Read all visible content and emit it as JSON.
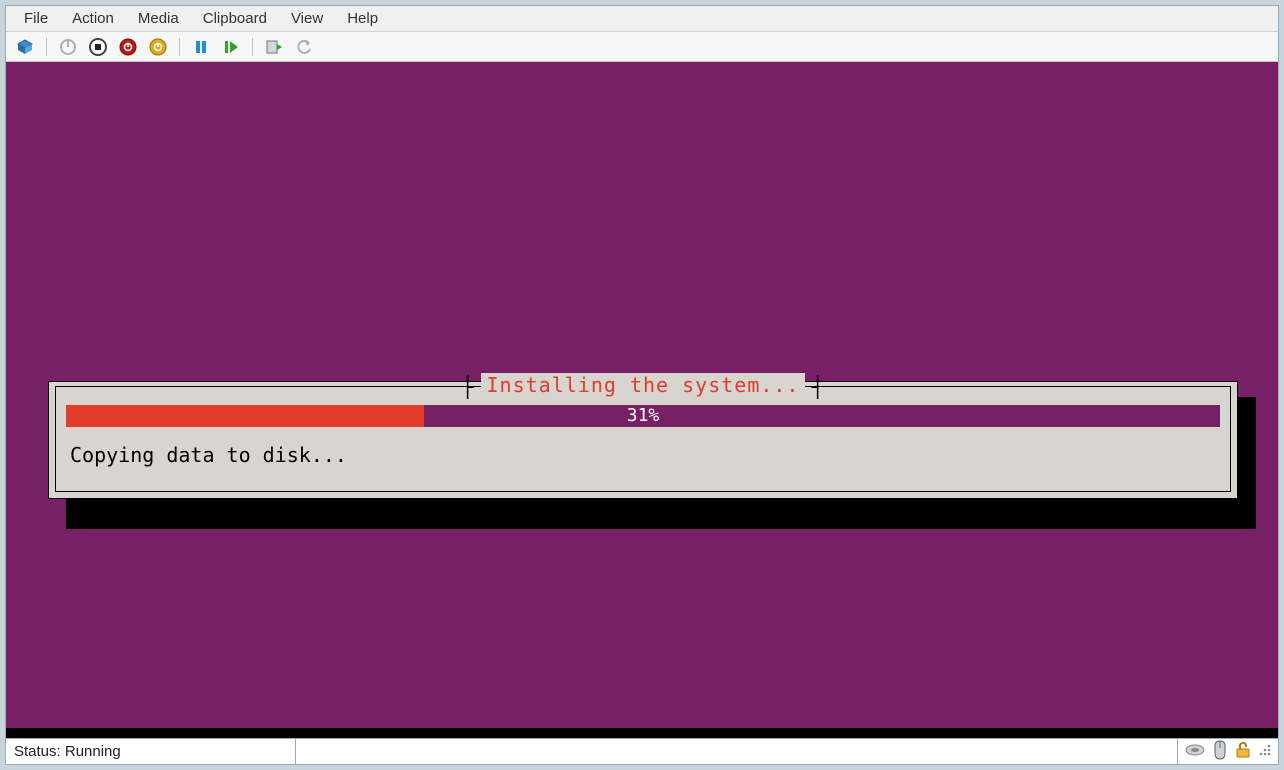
{
  "menu": {
    "file": "File",
    "action": "Action",
    "media": "Media",
    "clipboard": "Clipboard",
    "view": "View",
    "help": "Help"
  },
  "installer": {
    "title": "Installing the system...",
    "progress_percent": 31,
    "progress_label": "31%",
    "status": "Copying data to disk..."
  },
  "statusbar": {
    "text": "Status: Running"
  },
  "colors": {
    "vm_bg": "#782066",
    "progress_fill": "#e13b2a",
    "title_color": "#e13b2a"
  },
  "toolbar_icons": [
    "server-icon",
    "power-off-icon",
    "power-on-icon",
    "shutdown-icon",
    "reset-icon",
    "pause-icon",
    "start-icon",
    "checkpoint-icon",
    "revert-icon"
  ],
  "status_icons": [
    "speaker-icon",
    "mouse-icon",
    "lock-icon",
    "resize-grip-icon"
  ]
}
